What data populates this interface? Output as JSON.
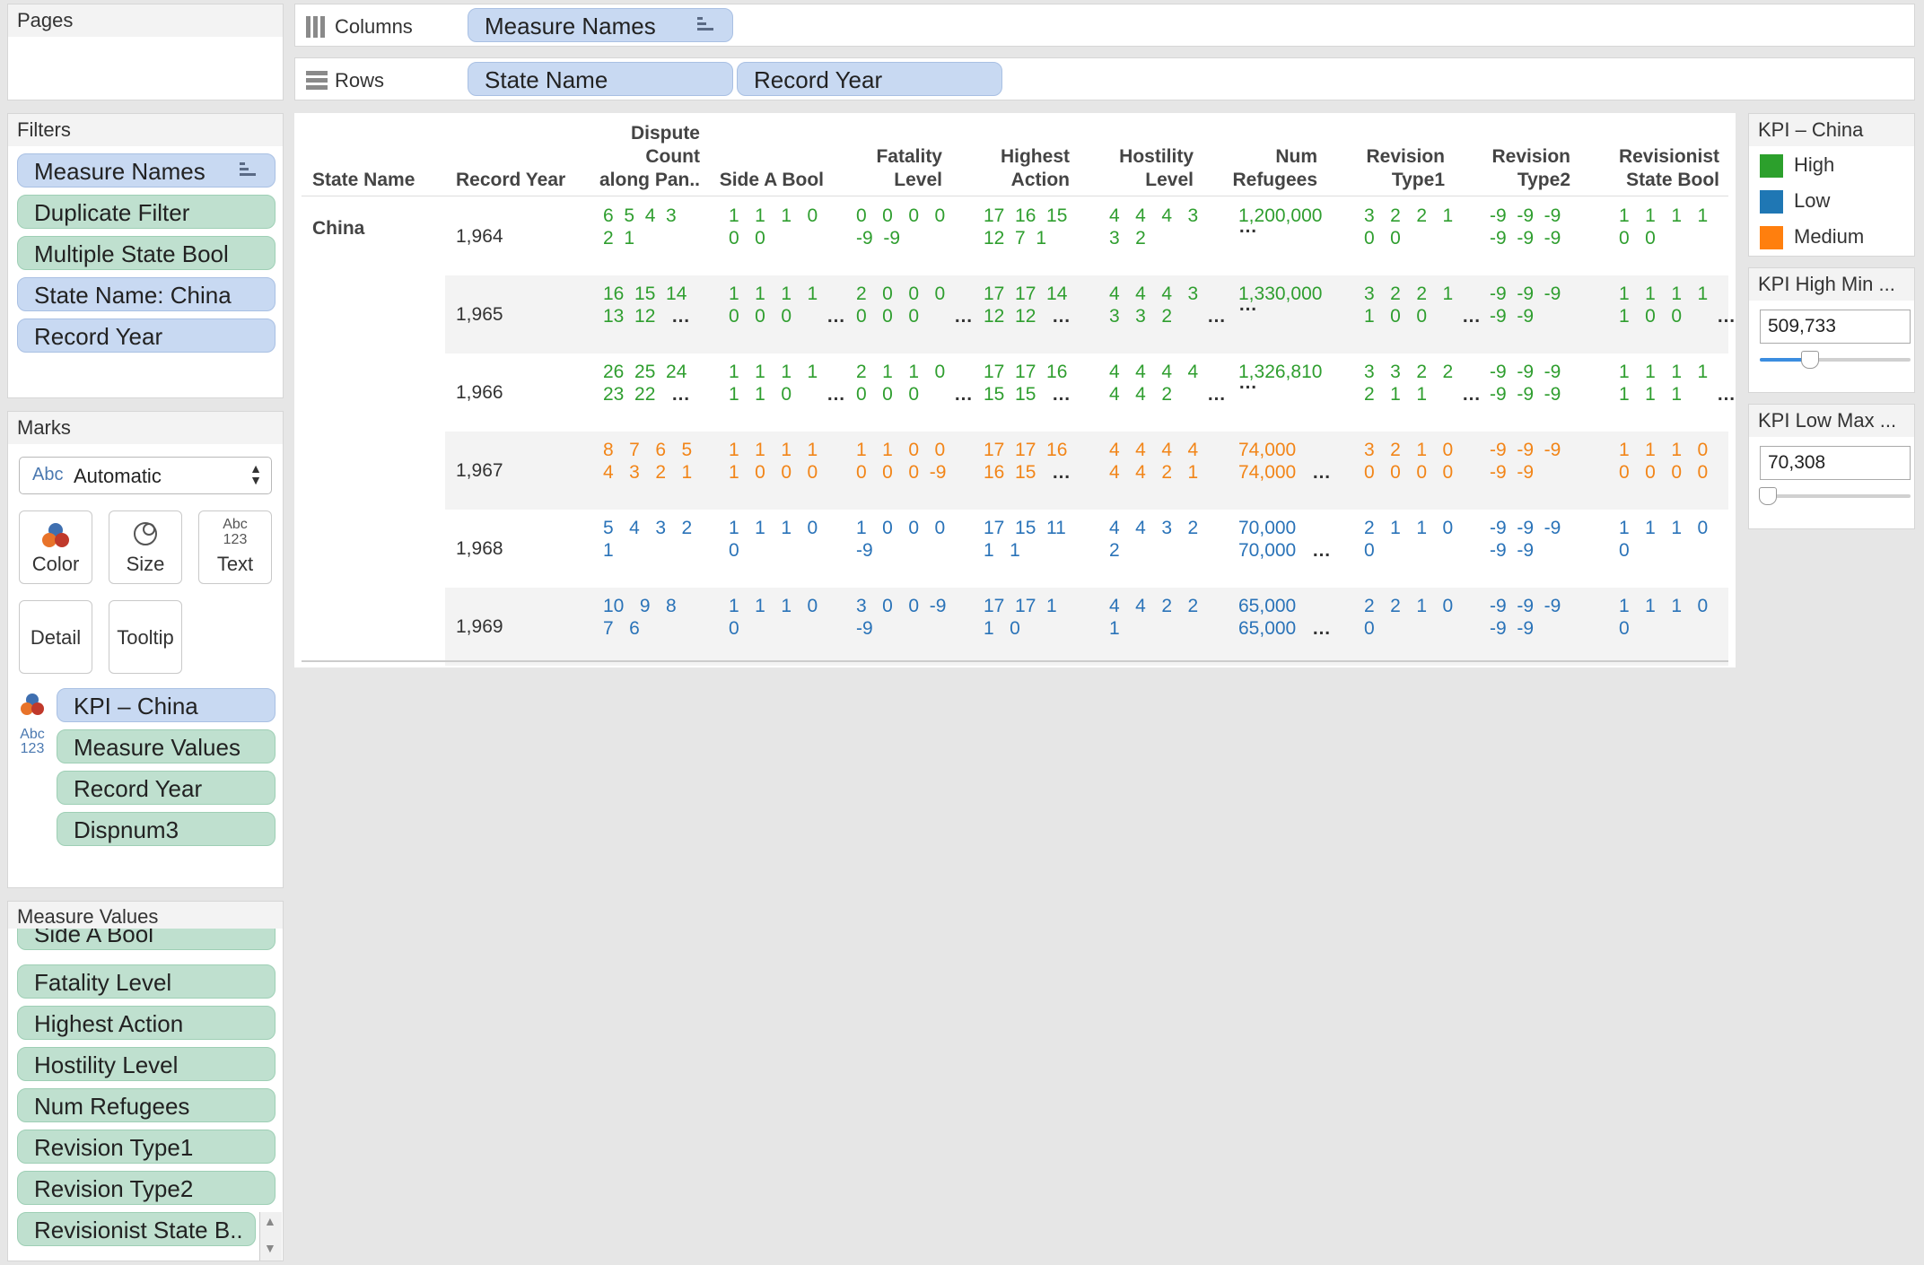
{
  "pages": {
    "title": "Pages"
  },
  "shelves": {
    "columns_label": "Columns",
    "rows_label": "Rows",
    "columns": [
      "Measure Names"
    ],
    "rows": [
      "State Name",
      "Record Year"
    ]
  },
  "filters": {
    "title": "Filters",
    "items": [
      "Measure Names",
      "Duplicate Filter",
      "Multiple State Bool",
      "State Name: China",
      "Record Year"
    ]
  },
  "marks": {
    "title": "Marks",
    "mark_type": "Automatic",
    "mark_type_icon": "Abc",
    "buttons": [
      "Color",
      "Size",
      "Text",
      "Detail",
      "Tooltip"
    ],
    "text_icon_line1": "Abc",
    "text_icon_line2": "123",
    "fields": [
      "KPI – China",
      "Measure Values",
      "Record Year",
      "Dispnum3"
    ]
  },
  "measure_values": {
    "title": "Measure Values",
    "items": [
      "Side A Bool",
      "Fatality Level",
      "Highest Action",
      "Hostility Level",
      "Num Refugees",
      "Revision Type1",
      "Revision Type2",
      "Revisionist State B.."
    ]
  },
  "table": {
    "headers": {
      "state_name": "State Name",
      "record_year": "Record Year",
      "dispute_1": "Dispute",
      "dispute_2": "Count",
      "dispute_3": "along Pan..",
      "side_a": "Side A Bool",
      "fatality_1": "Fatality",
      "fatality_2": "Level",
      "highest_1": "Highest",
      "highest_2": "Action",
      "hostility_1": "Hostility",
      "hostility_2": "Level",
      "refugees_1": "Num",
      "refugees_2": "Refugees",
      "rev1_1": "Revision",
      "rev1_2": "Type1",
      "rev2_1": "Revision",
      "rev2_2": "Type2",
      "revstate_1": "Revisionist",
      "revstate_2": "State Bool"
    },
    "state": "China",
    "rows": [
      {
        "year": "1,964",
        "kpi": "High",
        "cells": [
          [
            "6  5  4  3",
            "2  1"
          ],
          [
            "1   1   1   0",
            "0   0"
          ],
          [
            "0   0   0   0",
            "-9  -9"
          ],
          [
            "17  16  15",
            "12  7  1"
          ],
          [
            "4   4   4   3",
            "3   2"
          ],
          [
            "1,200,000",
            ""
          ],
          [
            "3   2   2   1",
            "0   0"
          ],
          [
            "-9  -9  -9",
            "-9  -9  -9"
          ],
          [
            "1   1   1   1",
            "0   0"
          ]
        ]
      },
      {
        "year": "1,965",
        "kpi": "High",
        "cells": [
          [
            "16  15  14",
            "13  12"
          ],
          [
            "1   1   1   1",
            "0   0   0"
          ],
          [
            "2   0   0   0",
            "0   0   0"
          ],
          [
            "17  17  14",
            "12  12"
          ],
          [
            "4   4   4   3",
            "3   3   2"
          ],
          [
            "1,330,000",
            ""
          ],
          [
            "3   2   2   1",
            "1   0   0"
          ],
          [
            "-9  -9  -9",
            "-9  -9"
          ],
          [
            "1   1   1   1",
            "1   0   0"
          ]
        ]
      },
      {
        "year": "1,966",
        "kpi": "High",
        "cells": [
          [
            "26  25  24",
            "23  22"
          ],
          [
            "1   1   1   1",
            "1   1   0"
          ],
          [
            "2   1   1   0",
            "0   0   0"
          ],
          [
            "17  17  16",
            "15  15"
          ],
          [
            "4   4   4   4",
            "4   4   2"
          ],
          [
            "1,326,810",
            ""
          ],
          [
            "3   3   2   2",
            "2   1   1"
          ],
          [
            "-9  -9  -9",
            "-9  -9  -9"
          ],
          [
            "1   1   1   1",
            "1   1   1"
          ]
        ]
      },
      {
        "year": "1,967",
        "kpi": "Medium",
        "cells": [
          [
            "8   7   6   5",
            "4   3   2   1"
          ],
          [
            "1   1   1   1",
            "1   0   0   0"
          ],
          [
            "1   1   0   0",
            "0   0   0  -9"
          ],
          [
            "17  17  16",
            "16  15"
          ],
          [
            "4   4   4   4",
            "4   4   2   1"
          ],
          [
            "74,000",
            "74,000"
          ],
          [
            "3   2   1   0",
            "0   0   0   0"
          ],
          [
            "-9  -9  -9",
            "-9  -9"
          ],
          [
            "1   1   1   0",
            "0   0   0   0"
          ]
        ]
      },
      {
        "year": "1,968",
        "kpi": "Low",
        "cells": [
          [
            "5   4   3   2",
            "1"
          ],
          [
            "1   1   1   0",
            "0"
          ],
          [
            "1   0   0   0",
            "-9"
          ],
          [
            "17  15  11",
            "1   1"
          ],
          [
            "4   4   3   2",
            "2"
          ],
          [
            "70,000",
            "70,000"
          ],
          [
            "2   1   1   0",
            "0"
          ],
          [
            "-9  -9  -9",
            "-9  -9"
          ],
          [
            "1   1   1   0",
            "0"
          ]
        ]
      },
      {
        "year": "1,969",
        "kpi": "Low",
        "cells": [
          [
            "10   9   8",
            "7   6"
          ],
          [
            "1   1   1   0",
            "0"
          ],
          [
            "3   0   0  -9",
            "-9"
          ],
          [
            "17  17  1",
            "1   0"
          ],
          [
            "4   4   2   2",
            "1"
          ],
          [
            "65,000",
            "65,000"
          ],
          [
            "2   2   1   0",
            "0"
          ],
          [
            "-9  -9  -9",
            "-9  -9"
          ],
          [
            "1   1   1   0",
            "0"
          ]
        ]
      }
    ],
    "ellipsis": "…"
  },
  "legend": {
    "title": "KPI – China",
    "items": [
      {
        "label": "High",
        "color": "#2ca02c"
      },
      {
        "label": "Low",
        "color": "#1f77b4"
      },
      {
        "label": "Medium",
        "color": "#ff7f0e"
      }
    ]
  },
  "param_high": {
    "title": "KPI High Min ...",
    "value": "509,733",
    "level": 0.33
  },
  "param_low": {
    "title": "KPI Low Max ...",
    "value": "70,308",
    "level": 0.05
  }
}
